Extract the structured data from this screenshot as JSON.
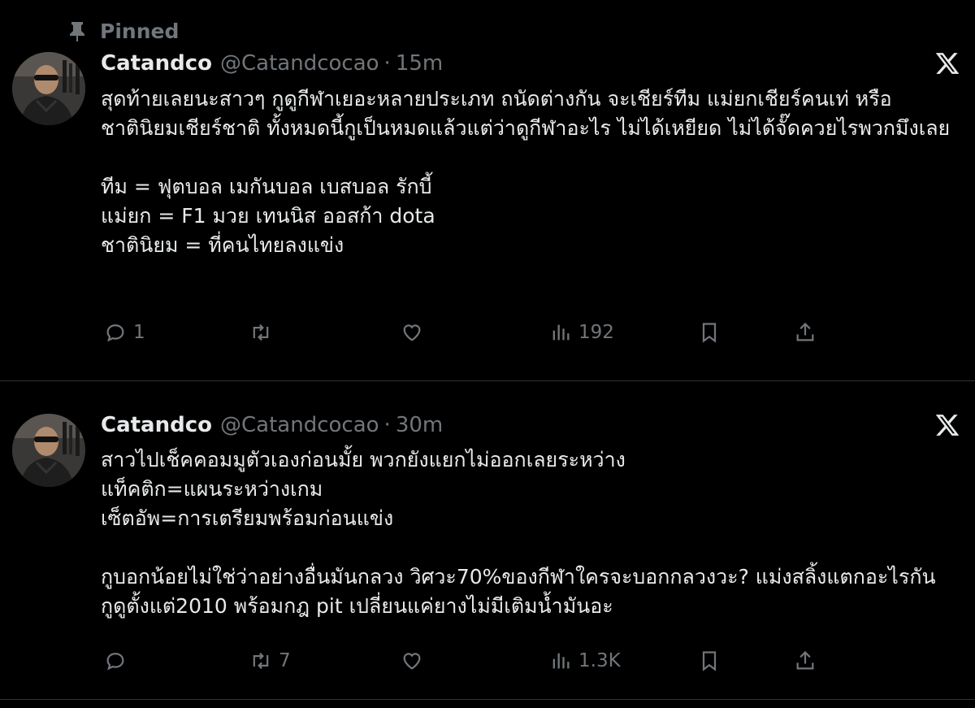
{
  "pinned_label": "Pinned",
  "tweets": [
    {
      "name": "Catandco",
      "handle": "@Catandcocao",
      "separator": "·",
      "time": "15m",
      "text": "สุดท้ายเลยนะสาวๆ กูดูกีฬาเยอะหลายประเภท ถนัดต่างกัน จะเชียร์ทีม แม่ยกเชียร์คนเท่ หรือชาตินิยมเชียร์ชาติ ทั้งหมดนี้กูเป็นหมดแล้วแต่ว่าดูกีฬาอะไร ไม่ได้เหยียด ไม่ได้จั๊ดควยไรพวกมึงเลย\n\nทีม = ฟุตบอล เมกันบอล เบสบอล รักบี้\nแม่ยก = F1 มวย เทนนิส ออสก้า dota\nชาตินิยม = ที่คนไทยลงแข่ง",
      "replies": "1",
      "retweets": "",
      "likes": "",
      "views": "192"
    },
    {
      "name": "Catandco",
      "handle": "@Catandcocao",
      "separator": "·",
      "time": "30m",
      "text": "สาวไปเช็คคอมมูตัวเองก่อนมั้ย พวกยังแยกไม่ออกเลยระหว่าง\nแท็คติก=แผนระหว่างเกม\nเซ็ตอัพ=การเตรียมพร้อมก่อนแข่ง\n\nกูบอกน้อยไม่ใช่ว่าอย่างอื่นมันกลวง วิศวะ70%ของกีฬาใครจะบอกกลวงวะ? แม่งสลิ้งแตกอะไรกัน กูดูตั้งแต่2010 พร้อมกฎ pit เปลี่ยนแค่ยางไม่มีเติมน้ำมันอะ",
      "replies": "",
      "retweets": "7",
      "likes": "",
      "views": "1.3K"
    }
  ],
  "colors": {
    "background": "#000000",
    "text": "#e7e9ea",
    "secondary": "#71767b",
    "divider": "#2f3336"
  },
  "icons": [
    "pin-icon",
    "x-logo-icon",
    "reply-icon",
    "retweet-icon",
    "like-icon",
    "views-icon",
    "bookmark-icon",
    "share-icon"
  ]
}
